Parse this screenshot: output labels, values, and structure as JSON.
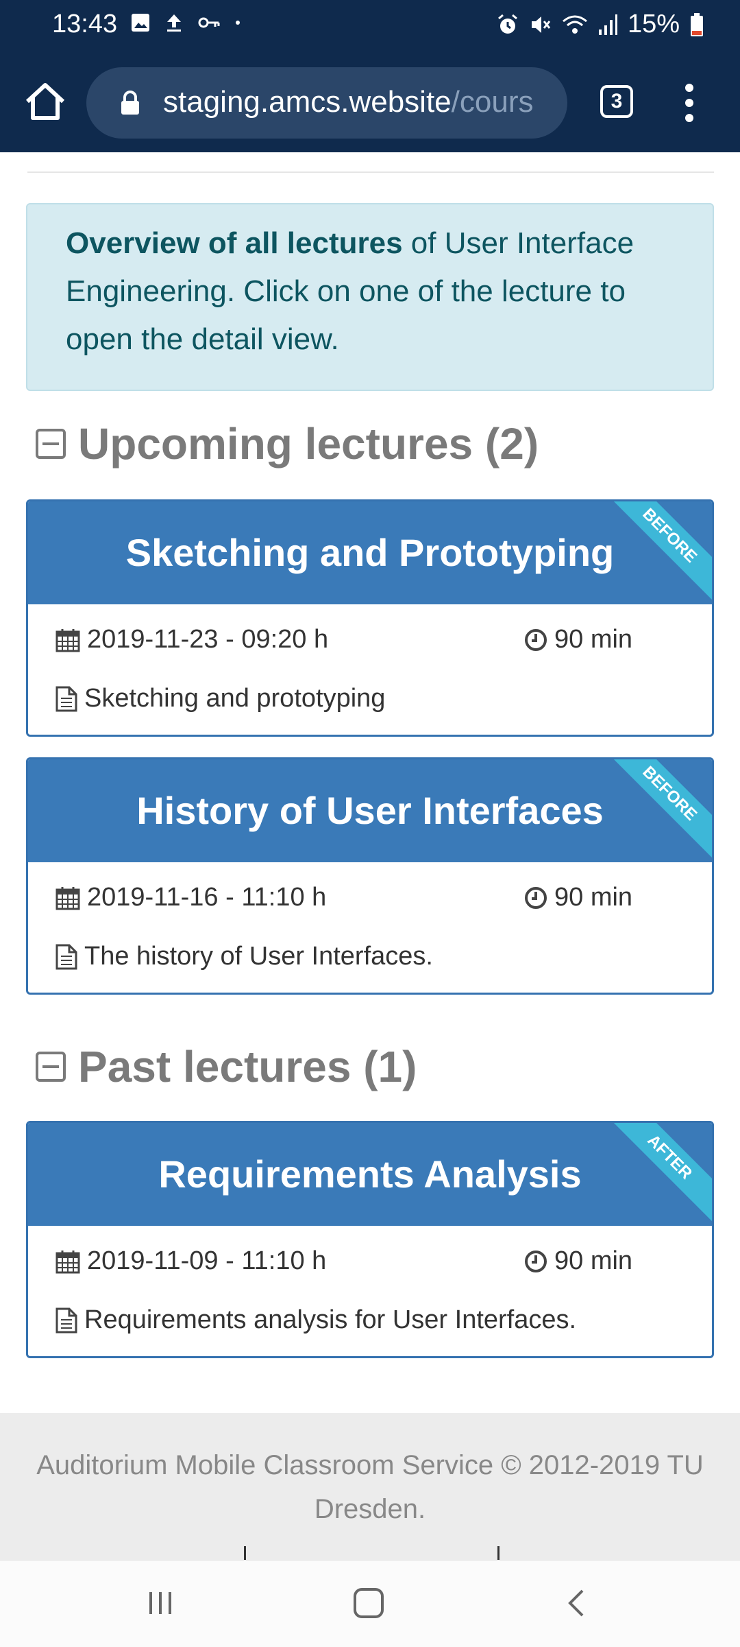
{
  "status": {
    "time": "13:43",
    "battery": "15%"
  },
  "browser": {
    "url_main": "staging.amcs.website",
    "url_rest": "/cours",
    "tab_count": "3"
  },
  "info": {
    "bold": "Overview of all lectures",
    "rest": " of User Interface Engineering. Click on one of the lecture to open the detail view."
  },
  "sections": {
    "upcoming": "Upcoming lectures (2)",
    "past": "Past lectures (1)"
  },
  "lectures": [
    {
      "title": "Sketching and Prototyping",
      "ribbon": "BEFORE",
      "date": "2019-11-23 - 09:20 h",
      "duration": "90 min",
      "desc": "Sketching and prototyping"
    },
    {
      "title": "History of User Interfaces",
      "ribbon": "BEFORE",
      "date": "2019-11-16 - 11:10 h",
      "duration": "90 min",
      "desc": "The history of User Interfaces."
    },
    {
      "title": "Requirements Analysis",
      "ribbon": "AFTER",
      "date": "2019-11-09 - 11:10 h",
      "duration": "90 min",
      "desc": "Requirements analysis for User Interfaces."
    }
  ],
  "footer": {
    "line1": "Auditorium Mobile Classroom Service © 2012-2019 TU",
    "line2": "Dresden."
  },
  "colors": {
    "brand_dark": "#0f2a4d",
    "card_blue": "#3a7ab8",
    "ribbon": "#3db7d8",
    "info_bg": "#d6ebf1"
  }
}
